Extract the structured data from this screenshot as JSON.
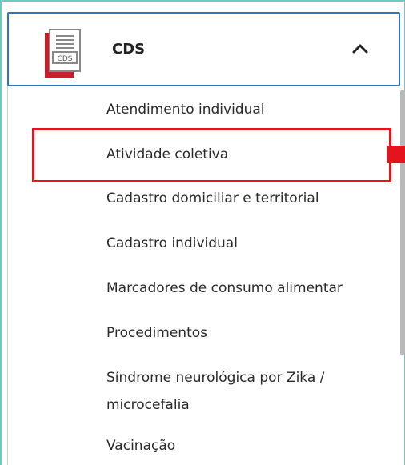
{
  "header": {
    "title": "CDS",
    "icon": "cds-document-icon",
    "icon_label": "CDS",
    "expanded": true,
    "chevron_icon": "chevron-up-icon"
  },
  "menu": {
    "items": [
      {
        "label": "Atendimento individual"
      },
      {
        "label": "Atividade coletiva",
        "highlighted": true
      },
      {
        "label": "Cadastro domiciliar e territorial"
      },
      {
        "label": "Cadastro individual"
      },
      {
        "label": "Marcadores de consumo alimentar"
      },
      {
        "label": "Procedimentos"
      },
      {
        "label": "Síndrome neurológica por Zika /",
        "label_line2": "microcefalia"
      },
      {
        "label": "Vacinação"
      }
    ]
  },
  "colors": {
    "accent_border": "#2d73c6",
    "highlight": "#e4141e",
    "outer_frame": "#6fc9c0",
    "icon_red": "#c8202a"
  }
}
